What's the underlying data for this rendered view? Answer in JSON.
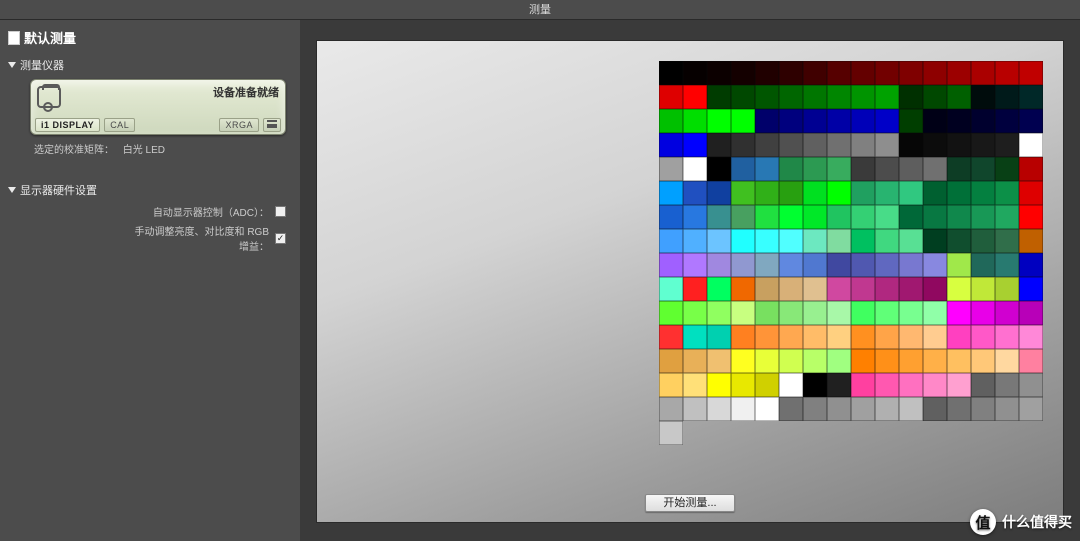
{
  "window": {
    "title": "测量"
  },
  "sidebar": {
    "panel_title": "默认测量",
    "section_instrument": "测量仪器",
    "section_monitor": "显示器硬件设置",
    "device": {
      "status": "设备准备就绪",
      "tab_i1display": "i1 DISPLAY",
      "tab_cal": "CAL",
      "tab_xrga": "XRGA"
    },
    "calibration_label": "选定的校准矩阵：",
    "calibration_value": "白光 LED",
    "adc_label": "自动显示器控制（ADC）：",
    "manual_label": "手动调整亮度、对比度和 RGB 增益："
  },
  "main": {
    "start_button": "开始测量..."
  },
  "watermark": {
    "badge": "值",
    "text": "什么值得买"
  },
  "chart_data": {
    "type": "heatmap",
    "title": "Color patch set (15 rows × 16 cols + 1 extra)",
    "rows": 15,
    "cols": 16,
    "extra_patches": 1,
    "colors": [
      [
        "#000000",
        "#060000",
        "#0c0000",
        "#140000",
        "#200000",
        "#2e0000",
        "#400000",
        "#560000",
        "#640000",
        "#720000",
        "#7f0000",
        "#8e0000",
        "#9c0000",
        "#aa0000",
        "#b80000",
        "#c00000"
      ],
      [
        "#de0000",
        "#ff0000",
        "#003c00",
        "#004800",
        "#005600",
        "#006600",
        "#007600",
        "#008600",
        "#009400",
        "#00a200",
        "#003000",
        "#004800",
        "#006000",
        "#000c0c",
        "#001a1a",
        "#002828"
      ],
      [
        "#00c000",
        "#00de00",
        "#00ff00",
        "#00ff00",
        "#00006a",
        "#00007e",
        "#000092",
        "#0000a6",
        "#0000b8",
        "#0000c8",
        "#003e00",
        "#000016",
        "#000020",
        "#00002e",
        "#00003e",
        "#000050"
      ],
      [
        "#0000e0",
        "#0000ff",
        "#202020",
        "#303030",
        "#404040",
        "#505050",
        "#606060",
        "#707070",
        "#808080",
        "#8e8e8e",
        "#060606",
        "#0c0c0c",
        "#121212",
        "#181818",
        "#1e1e1e",
        "#ffffff"
      ],
      [
        "#a0a0a0",
        "#ffffff",
        "#000000",
        "#2060a0",
        "#2878b4",
        "#208848",
        "#2c9a52",
        "#38ac5e",
        "#3a3a3a",
        "#4c4c4c",
        "#5e5e5e",
        "#707070",
        "#0d3d25",
        "#10462c",
        "#084015",
        "#b80000"
      ],
      [
        "#00a0ff",
        "#2050c0",
        "#1040a0",
        "#40c020",
        "#30b018",
        "#28a010",
        "#00e020",
        "#00ff00",
        "#20a060",
        "#28b470",
        "#30c880",
        "#006030",
        "#007038",
        "#048040",
        "#0c9048",
        "#de0000"
      ],
      [
        "#1860d0",
        "#2878e0",
        "#389090",
        "#48a060",
        "#20e040",
        "#00ff30",
        "#00e828",
        "#20c460",
        "#34d074",
        "#48dc88",
        "#006838",
        "#087842",
        "#10884c",
        "#189856",
        "#20a860",
        "#ff0000"
      ],
      [
        "#40a0ff",
        "#50b0ff",
        "#6cc4ff",
        "#20ffff",
        "#38ffff",
        "#50ffff",
        "#6ce8c0",
        "#80dca0",
        "#00c060",
        "#40d880",
        "#58e094",
        "#003e20",
        "#104e2e",
        "#205e3c",
        "#306e4a",
        "#c06000"
      ],
      [
        "#a060ff",
        "#b078ff",
        "#a088e0",
        "#9098d0",
        "#80a8c0",
        "#6088e0",
        "#5078d0",
        "#4048a0",
        "#5058b0",
        "#6068c0",
        "#7878d0",
        "#8888e0",
        "#a0e84a",
        "#20685a",
        "#287a70",
        "#0000c0"
      ],
      [
        "#60ffd0",
        "#ff2020",
        "#00ff60",
        "#f06800",
        "#c8a060",
        "#d8b078",
        "#e0c090",
        "#d048a0",
        "#c03890",
        "#b02880",
        "#a01870",
        "#900860",
        "#d8ff40",
        "#c0e838",
        "#a8d030",
        "#0000ff"
      ],
      [
        "#60ff30",
        "#78ff48",
        "#90ff60",
        "#c8ff80",
        "#78e060",
        "#88e878",
        "#98f090",
        "#a8f8a8",
        "#40ff60",
        "#60ff78",
        "#78ff90",
        "#90ffa8",
        "#ff00ff",
        "#e800e8",
        "#d000d0",
        "#b800b8"
      ],
      [
        "#ff3030",
        "#00e0c0",
        "#00d0b0",
        "#ff8020",
        "#ff9438",
        "#ffa850",
        "#ffbc68",
        "#ffd080",
        "#ff9020",
        "#ffa448",
        "#ffb870",
        "#ffcc90",
        "#ff40c0",
        "#ff58c8",
        "#ff70d0",
        "#ff88d8"
      ],
      [
        "#e0a040",
        "#e8b058",
        "#f0c070",
        "#ffff20",
        "#e8ff38",
        "#d0ff50",
        "#b8ff68",
        "#a0ff80",
        "#ff8000",
        "#ff9018",
        "#ffa030",
        "#ffb048",
        "#ffc060",
        "#ffc878",
        "#ffd8a0",
        "#ff80a0"
      ],
      [
        "#ffd060",
        "#ffe078",
        "#ffff00",
        "#e8e800",
        "#d0d000",
        "#ffffff",
        "#000000",
        "#202020",
        "#ff40a0",
        "#ff58b0",
        "#ff70c0",
        "#ff88c8",
        "#ffa0d0",
        "#606060",
        "#787878",
        "#909090"
      ],
      [
        "#a8a8a8",
        "#c0c0c0",
        "#d8d8d8",
        "#f0f0f0",
        "#ffffff",
        "#707070",
        "#808080",
        "#909090",
        "#a0a0a0",
        "#b0b0b0",
        "#c0c0c0",
        "#606060",
        "#707070",
        "#808080",
        "#909090",
        "#a0a0a0"
      ]
    ],
    "extra_colors": [
      "#c8c8c8"
    ]
  }
}
